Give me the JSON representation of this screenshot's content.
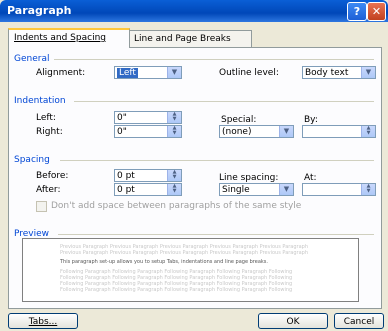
{
  "window": {
    "title": "Paragraph",
    "help_glyph": "?",
    "close_glyph": "✕"
  },
  "tabs": [
    {
      "label": "Indents and Spacing"
    },
    {
      "label": "Line and Page Breaks"
    }
  ],
  "general": {
    "heading": "General",
    "alignment_label": "Alignment:",
    "alignment_value": "Left",
    "outline_label": "Outline level:",
    "outline_value": "Body text"
  },
  "indentation": {
    "heading": "Indentation",
    "left_label": "Left:",
    "left_value": "0\"",
    "right_label": "Right:",
    "right_value": "0\"",
    "special_label": "Special:",
    "special_value": "(none)",
    "by_label": "By:",
    "by_value": ""
  },
  "spacing": {
    "heading": "Spacing",
    "before_label": "Before:",
    "before_value": "0 pt",
    "after_label": "After:",
    "after_value": "0 pt",
    "line_spacing_label": "Line spacing:",
    "line_spacing_value": "Single",
    "at_label": "At:",
    "at_value": "",
    "no_space_checkbox_label": "Don't add space between paragraphs of the same style"
  },
  "preview": {
    "heading": "Preview",
    "sample_prev": "Previous Paragraph Previous Paragraph Previous Paragraph Previous Paragraph Previous Paragraph",
    "sample_text": "This paragraph set-up allows you to setup Tabs, indentations and line page breaks.",
    "sample_next": "Following Paragraph Following Paragraph Following Paragraph Following Paragraph Following"
  },
  "buttons": {
    "tabs": "Tabs...",
    "ok": "OK",
    "cancel": "Cancel"
  },
  "colors": {
    "title_bar": "#0047b8",
    "section_heading": "#0046d5",
    "selection": "#316ac5",
    "dialog_bg": "#ece9d8"
  }
}
